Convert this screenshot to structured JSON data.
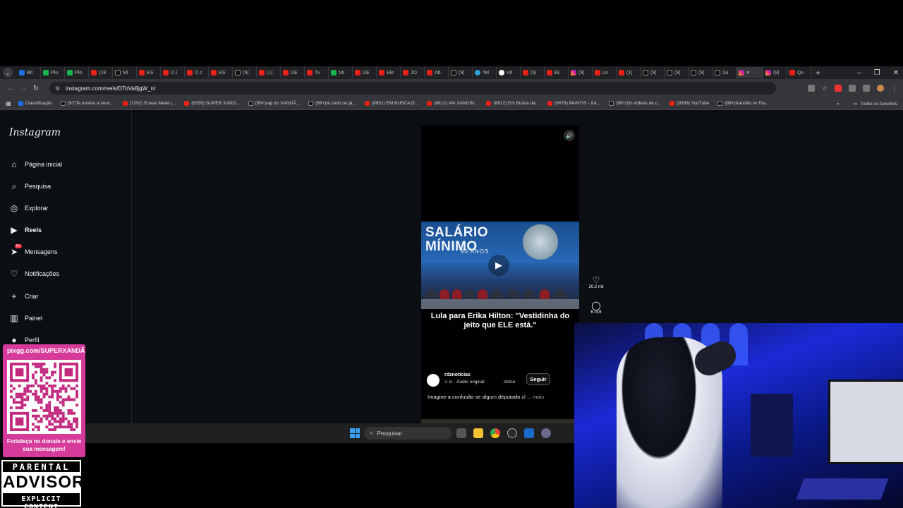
{
  "browser": {
    "tabs": [
      {
        "icon": "bl",
        "label": "Bit"
      },
      {
        "icon": "gr",
        "label": "Plu"
      },
      {
        "icon": "gr",
        "label": "Plo"
      },
      {
        "icon": "yt",
        "label": "(18"
      },
      {
        "icon": "tt",
        "label": "Mi"
      },
      {
        "icon": "yt",
        "label": "ES"
      },
      {
        "icon": "yt",
        "label": "O l"
      },
      {
        "icon": "yt",
        "label": "O c"
      },
      {
        "icon": "yt",
        "label": "ES"
      },
      {
        "icon": "tt",
        "label": "(9("
      },
      {
        "icon": "yt",
        "label": "(1("
      },
      {
        "icon": "yt",
        "label": "DE"
      },
      {
        "icon": "yt",
        "label": "Tu"
      },
      {
        "icon": "gr",
        "label": "Stı"
      },
      {
        "icon": "yt",
        "label": "DE"
      },
      {
        "icon": "yt",
        "label": "Ele"
      },
      {
        "icon": "yt",
        "label": "JO"
      },
      {
        "icon": "yt",
        "label": "Ab"
      },
      {
        "icon": "tt",
        "label": "(9("
      },
      {
        "icon": "tg",
        "label": "Tel"
      },
      {
        "icon": "gg",
        "label": "VII"
      },
      {
        "icon": "yt",
        "label": "(6("
      },
      {
        "icon": "yt",
        "label": "BL"
      },
      {
        "icon": "ig",
        "label": "(9)"
      },
      {
        "icon": "yt",
        "label": "Lo"
      },
      {
        "icon": "yt",
        "label": "(1("
      },
      {
        "icon": "tt",
        "label": "(9("
      },
      {
        "icon": "tt",
        "label": "(9("
      },
      {
        "icon": "tt",
        "label": "(9("
      },
      {
        "icon": "tt",
        "label": "Su"
      },
      {
        "icon": "ig",
        "label": "×",
        "active": true
      },
      {
        "icon": "ig",
        "label": "(9)"
      },
      {
        "icon": "yt",
        "label": "Qu"
      }
    ],
    "new_tab": "+",
    "window_controls": {
      "minimize": "–",
      "maximize": "❐",
      "close": "✕"
    },
    "nav": {
      "back": "←",
      "forward": "→",
      "reload": "↻"
    },
    "url": "instagram.com/reels/DToVa8jgW_n/",
    "bookmarks": [
      {
        "icon": "bl",
        "label": "Classificação"
      },
      {
        "icon": "tt",
        "label": "(97)Te ensino a venc..."
      },
      {
        "icon": "yt",
        "label": "(7292) Eneas Metal |..."
      },
      {
        "icon": "yt",
        "label": "(8159) SUPER XAND..."
      },
      {
        "icon": "tt",
        "label": "(99+)rap do XANDÃ..."
      },
      {
        "icon": "tt",
        "label": "(99+)tá cedo ou já..."
      },
      {
        "icon": "yt",
        "label": "(8851) EM BUSCA D..."
      },
      {
        "icon": "yt",
        "label": "(8912) VAI XANDIN..."
      },
      {
        "icon": "yt",
        "label": "(8912) Em Busca da..."
      },
      {
        "icon": "yt",
        "label": "(9078) MANTIS - XA..."
      },
      {
        "icon": "tt",
        "label": "(99+)Os vídeos de c..."
      },
      {
        "icon": "yt",
        "label": "(9338) YouTube"
      },
      {
        "icon": "tt",
        "label": "(99+)Xandão vs Fra..."
      }
    ],
    "all_favorites": "Todos os favoritos"
  },
  "instagram": {
    "logo": "Instagram",
    "nav": [
      {
        "icon": "⌂",
        "label": "Página inicial",
        "name": "home"
      },
      {
        "icon": "⌕",
        "label": "Pesquisa",
        "name": "search"
      },
      {
        "icon": "◎",
        "label": "Explorar",
        "name": "explore"
      },
      {
        "icon": "▶",
        "label": "Reels",
        "name": "reels",
        "bold": true
      },
      {
        "icon": "➤",
        "label": "Mensagens",
        "name": "messages",
        "badge": "9+"
      },
      {
        "icon": "♡",
        "label": "Notificações",
        "name": "notifications"
      },
      {
        "icon": "+",
        "label": "Criar",
        "name": "create"
      },
      {
        "icon": "▥",
        "label": "Painel",
        "name": "dashboard"
      },
      {
        "icon": "●",
        "label": "Perfil",
        "name": "profile"
      }
    ],
    "reel": {
      "thumb_title": "SALÁRIO\nMÍNIMO",
      "thumb_sub": "90 ANOS",
      "headline": "Lula para Erika Hilton: \"Vestidinha do jeito que ELE está.\"",
      "author": "rdznoticias",
      "audio": "♫ is · Áudio original",
      "audio_user": "rdzno",
      "follow": "Seguir",
      "caption": "Imagine a confusão se algum deputado cl",
      "caption_more": "... mais",
      "likes": "20,2 mil",
      "comments": "6.016"
    }
  },
  "taskbar": {
    "search_placeholder": "Pesquisar"
  },
  "overlay": {
    "qr_url": "pixgg.com/SUPERXANDÃ",
    "qr_text": "Fortaleça no donate e envie sua mensagem!",
    "advisory_line1": "PARENTAL",
    "advisory_line2": "ADVISORY",
    "advisory_line3": "EXPLICIT CONTENT"
  },
  "colors": {
    "overlay_pink": "#d63a9a",
    "like_badge": "#ff3040",
    "browser_bg": "#202124"
  }
}
